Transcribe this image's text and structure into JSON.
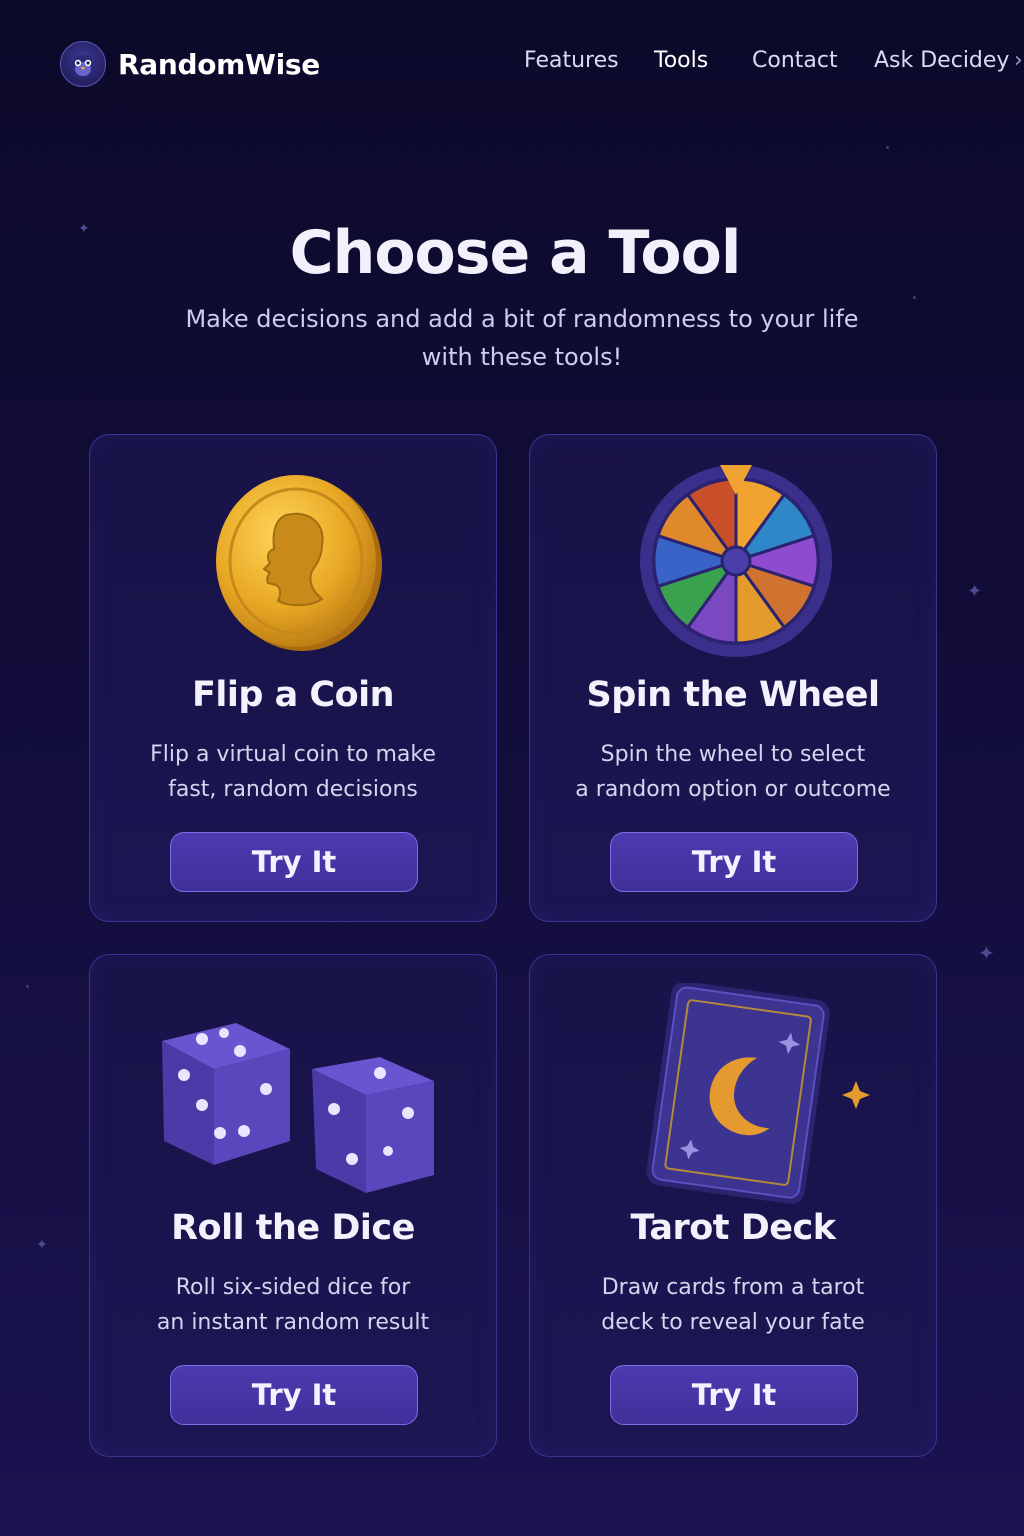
{
  "brand": {
    "name": "RandomWise",
    "logo_icon": "penguin-logo-icon"
  },
  "nav": {
    "links": [
      "Features",
      "Tools",
      "Contact",
      "Ask Decidey"
    ],
    "more_icon": "chevron-right-icon"
  },
  "hero": {
    "title": "Choose a Tool",
    "subtitle": "Make decisions and add a bit of randomness to your life with these tools!"
  },
  "tools": [
    {
      "title": "Flip a Coin",
      "desc_lines": [
        "Flip a virtual coin to make",
        "fast, random decisions"
      ],
      "button": "Try It",
      "icon": "coin-icon"
    },
    {
      "title": "Spin the Wheel",
      "desc_lines": [
        "Spin the wheel to select",
        "a random option or outcome"
      ],
      "button": "Try It",
      "icon": "wheel-icon"
    },
    {
      "title": "Roll the Dice",
      "desc_lines": [
        "Roll six-sided dice for",
        "an instant random result"
      ],
      "button": "Try It",
      "icon": "dice-icon"
    },
    {
      "title": "Tarot Deck",
      "desc_lines": [
        "Draw cards from a tarot",
        "deck to reveal your fate"
      ],
      "button": "Try It",
      "icon": "tarot-card-icon"
    }
  ],
  "colors": {
    "background": "#120d3a",
    "card_border": "#3b3391",
    "button": "#4d3ab0",
    "button_border": "#7a6ee6",
    "coin_gold": "#e6a824",
    "moon": "#e59a2f"
  }
}
